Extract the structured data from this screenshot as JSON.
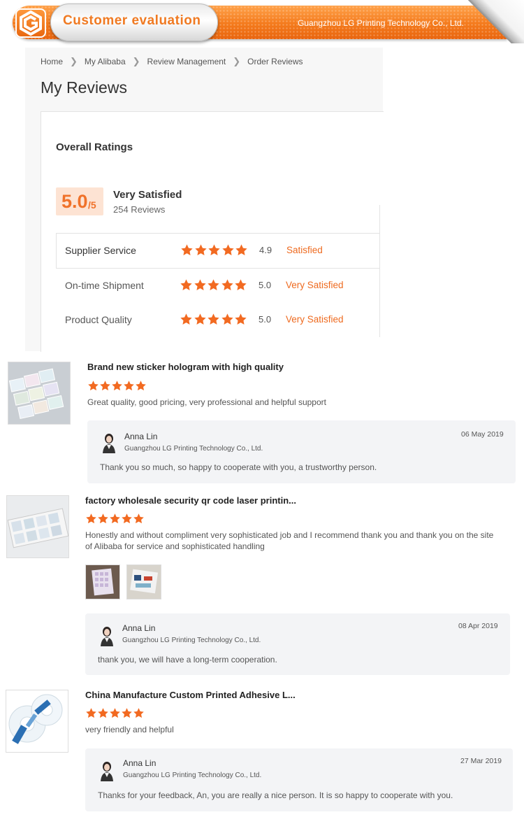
{
  "banner": {
    "logo_letter": "G",
    "title": "Customer evaluation",
    "company": "Guangzhou LG Printing Technology Co., Ltd.",
    "accent_color": "#f47a1c"
  },
  "breadcrumb": [
    "Home",
    "My Alibaba",
    "Review Management",
    "Order Reviews"
  ],
  "page_title": "My Reviews",
  "overall": {
    "title": "Overall Ratings",
    "score": "5.0",
    "score_max": "/5",
    "label": "Very Satisfied",
    "count": "254 Reviews",
    "rows": [
      {
        "label": "Supplier Service",
        "stars": 5,
        "score": "4.9",
        "status": "Satisfied"
      },
      {
        "label": "On-time Shipment",
        "stars": 5,
        "score": "5.0",
        "status": "Very Satisfied"
      },
      {
        "label": "Product Quality",
        "stars": 5,
        "score": "5.0",
        "status": "Very Satisfied"
      }
    ]
  },
  "reviews": [
    {
      "product": "Brand new sticker hologram with high quality",
      "stars": 5,
      "text": "Great quality, good pricing, very professional and helpful support",
      "reply": {
        "name": "Anna Lin",
        "company": "Guangzhou LG Printing Technology Co., Ltd.",
        "date": "06 May 2019",
        "text": "Thank you so much, so happy to cooperate with you, a trustworthy person."
      }
    },
    {
      "product": "factory wholesale security qr code laser printin...",
      "stars": 5,
      "text": "Honestly and without compliment very sophisticated job and I recommend thank you and thank you on the site of Alibaba for service and sophisticated handling",
      "reply": {
        "name": "Anna Lin",
        "company": "Guangzhou LG Printing Technology Co., Ltd.",
        "date": "08 Apr 2019",
        "text": "thank you, we will have a long-term cooperation."
      }
    },
    {
      "product": "China Manufacture Custom Printed Adhesive L...",
      "stars": 5,
      "text": "very friendly and helpful",
      "reply": {
        "name": "Anna Lin",
        "company": "Guangzhou LG Printing Technology Co., Ltd.",
        "date": "27 Mar 2019",
        "text": "Thanks for your feedback, An, you are really a nice person. It is so happy to cooperate with you."
      }
    }
  ],
  "colors": {
    "star": "#f26a21",
    "status": "#ee6a1f",
    "score_bg": "#fde3d3"
  },
  "icons": [
    "logo-g-icon",
    "chevron-right-icon",
    "star-icon",
    "avatar-icon",
    "product-thumbnail"
  ]
}
